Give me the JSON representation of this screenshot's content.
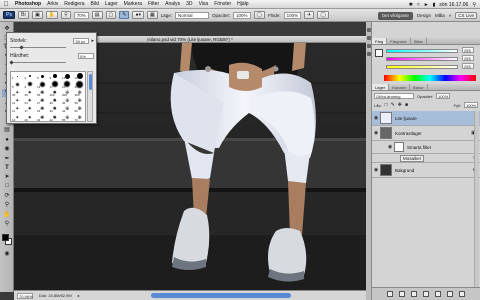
{
  "menubar": {
    "app": "Photoshop",
    "items": [
      "Arkiv",
      "Redigera",
      "Bild",
      "Lager",
      "Markera",
      "Filter",
      "Analys",
      "3D",
      "Visa",
      "Fönster",
      "Hjälp"
    ],
    "clock": "sön 16.17.06",
    "status_icons": [
      "bluetooth-icon",
      "wifi-icon",
      "volume-icon",
      "battery-icon"
    ]
  },
  "options": {
    "mode_label": "Läge:",
    "mode_value": "Normal",
    "opacity_label": "Opacitet:",
    "opacity_value": "100%",
    "flow_label": "Flöde:",
    "flow_value": "100%",
    "zoom_value": "70%"
  },
  "workspace": {
    "active": "Det viktigaste",
    "items": [
      "Design",
      "Måla"
    ],
    "cslive": "CS Live"
  },
  "brush_panel": {
    "size_label": "Storlek:",
    "size_value": "50 px",
    "hardness_label": "Hårdhet:",
    "hardness_value": "0%",
    "sizes": [
      "1",
      "3",
      "5",
      "9",
      "13",
      "19",
      "5",
      "9",
      "13",
      "17",
      "21",
      "27",
      "35",
      "45",
      "65",
      "100",
      "200",
      "300",
      "14",
      "24",
      "27",
      "39",
      "46",
      "59",
      "11",
      "17",
      "23",
      "36",
      "44",
      "60",
      "14",
      "26",
      "33",
      "42",
      "55",
      "70"
    ]
  },
  "document": {
    "title": "milano.psd vid 70% (Lite ljusare, RGB/8*) *",
    "zoom": "70,96%",
    "doc_info": "Dok: 24,8M/62,9M"
  },
  "color_panel": {
    "tabs": [
      "Färg",
      "Färgrutor",
      "Stilar"
    ],
    "values": [
      "255",
      "255",
      "255"
    ]
  },
  "layers_panel": {
    "tabs": [
      "Lager",
      "Kanaler",
      "Banor"
    ],
    "blend": "Oförd.ändring",
    "opacity_label": "Opacitet:",
    "opacity_value": "100%",
    "lock_label": "Lås:",
    "fill_label": "Fyll:",
    "fill_value": "100%",
    "layers": [
      {
        "name": "Lite ljusare",
        "selected": true
      },
      {
        "name": "Kontrastlager",
        "selected": false
      },
      {
        "name": "Smarta filter",
        "selected": false
      },
      {
        "name": "Mosaiker",
        "selected": false
      },
      {
        "name": "Bakgrund",
        "selected": false
      }
    ]
  },
  "tools": [
    "move",
    "marquee",
    "lasso",
    "quick-select",
    "crop",
    "eyedropper",
    "healing",
    "brush",
    "stamp",
    "history",
    "eraser",
    "gradient",
    "blur",
    "dodge",
    "pen",
    "type",
    "path-select",
    "shape",
    "3d-rotate",
    "3d-camera",
    "hand",
    "zoom"
  ],
  "colors": {
    "accent": "#9cb6d8",
    "selected_layer": "#a7bedb",
    "scroll": "#5a8ad4"
  }
}
